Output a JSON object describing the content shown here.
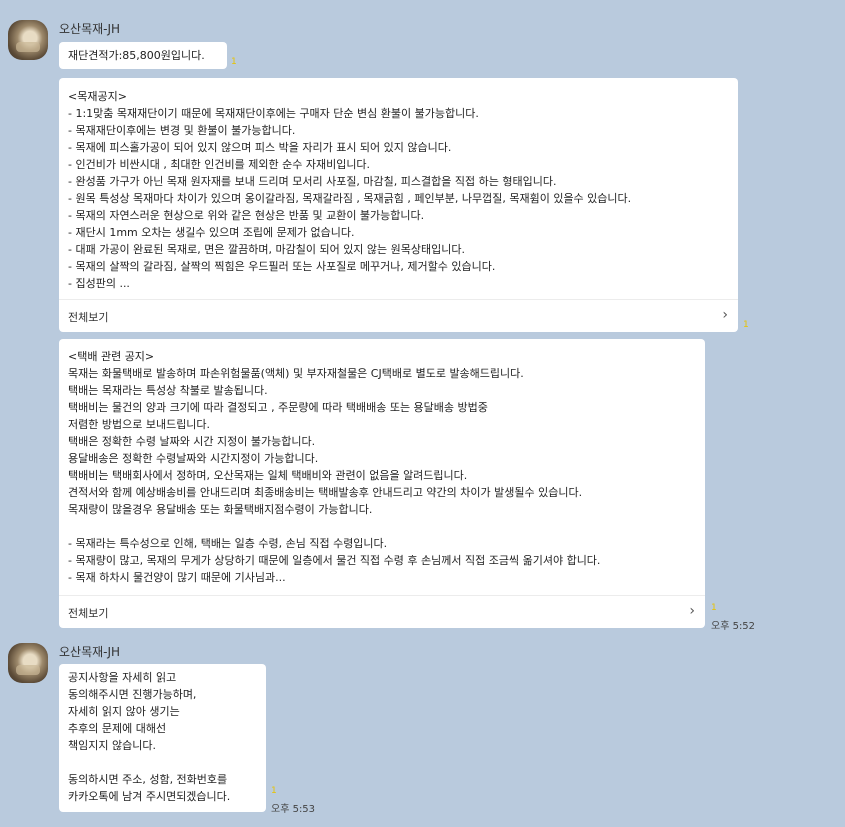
{
  "messages": [
    {
      "sender": "오산목재-JH",
      "text": "재단견적가:85,800원입니다.",
      "unread": "1"
    },
    {
      "text": "<목재공지>\n- 1:1맞춤 목재재단이기 때문에 목재재단이후에는 구매자 단순 변심 환불이 불가능합니다.\n- 목재재단이후에는 변경 및 환불이 불가능합니다.\n- 목재에 피스홀가공이 되어 있지 않으며 피스 박을 자리가 표시 되어 있지 않습니다.\n- 인건비가 비싼시대 , 최대한 인건비를 제외한 순수 자재비입니다.\n- 완성품 가구가 아닌 목재 원자재를 보내 드리며 모서리 사포질, 마감칠, 피스결합을 직접 하는 형태입니다.\n- 원목 특성상 목재마다 차이가 있으며 옹이갈라짐, 목재갈라짐 , 목재긁힘 , 페인부분, 나무껍질, 목재휨이 있을수 있습니다.\n- 목재의 자연스러운 현상으로 위와 같은 현상은 반품 및 교환이 불가능합니다.\n- 재단시 1mm 오차는 생길수 있으며 조립에 문제가 없습니다.\n- 대패 가공이 완료된 목재로, 면은 깔끔하며, 마감칠이 되어 있지 않는 원목상태입니다.\n- 목재의 살짝의 갈라짐, 살짝의 찍힘은 우드필러 또는 사포질로 메꾸거나, 제거할수 있습니다.\n- 집성판의 ...",
      "more_label": "전체보기",
      "unread": "1"
    },
    {
      "text": "<택배 관련 공지>\n목재는 화물택배로 발송하며 파손위험물품(액체) 및 부자재철물은 CJ택배로 별도로 발송해드립니다.\n택배는 목재라는 특성상 착불로 발송됩니다.\n택배비는 물건의 양과 크기에 따라 결정되고 , 주문량에 따라 택배배송 또는 용달배송 방법중\n저렴한 방법으로 보내드립니다.\n택배은 정확한 수령 날짜와 시간 지정이 불가능합니다.\n용달배송은 정확한 수령날짜와 시간지정이 가능합니다.\n택배비는 택배회사에서 정하며, 오산목재는 일체 택배비와 관련이 없음을 알려드립니다.\n견적서와 함께 예상배송비를 안내드리며 최종배송비는 택배발송후 안내드리고 약간의 차이가 발생될수 있습니다.\n목재량이 많을경우 용달배송 또는 화물택배지점수령이 가능합니다.\n\n- 목재라는 특수성으로 인해, 택배는 일층 수령, 손님 직접 수령입니다.\n- 목재량이 많고, 목재의 무게가 상당하기 때문에 일층에서 물건 직접 수령 후 손님께서 직접 조금씩 옮기셔야 합니다.\n- 목재 하차시 물건양이 많기 때문에 기사님과...",
      "more_label": "전체보기",
      "unread": "1",
      "time": "오후 5:52"
    },
    {
      "sender": "오산목재-JH",
      "text": "공지사항을 자세히 읽고\n동의해주시면 진행가능하며,\n자세히 읽지 않아 생기는\n추후의 문제에 대해선\n책임지지 않습니다.\n\n동의하시면 주소, 성함, 전화번호를\n카카오톡에 남겨 주시면되겠습니다.",
      "unread": "1",
      "time": "오후 5:53"
    }
  ],
  "colors": {
    "background": "#b9cadd",
    "bubble": "#ffffff",
    "unread": "#e8c300"
  },
  "icons": {
    "avatar": "wood-profile-avatar",
    "chevron": "chevron-right-icon"
  }
}
